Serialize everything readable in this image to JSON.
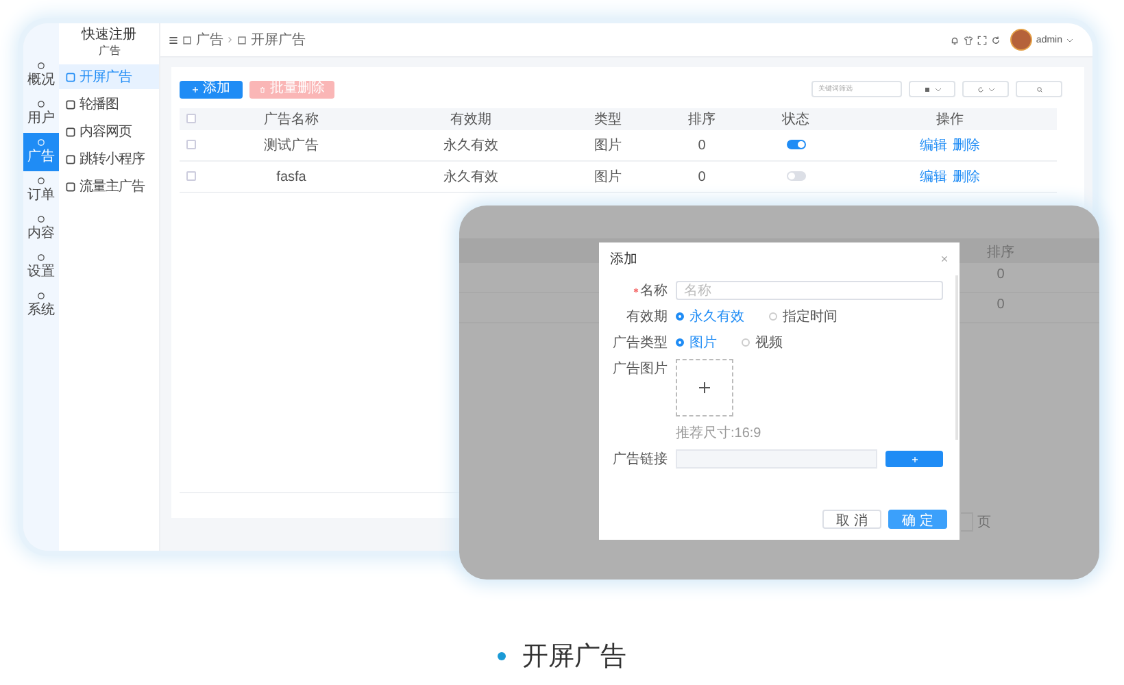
{
  "app": {
    "title": "快速注册",
    "subtitle": "广告"
  },
  "rail": [
    {
      "label": "概况",
      "selected": false
    },
    {
      "label": "用户",
      "selected": false
    },
    {
      "label": "广告",
      "selected": true
    },
    {
      "label": "订单",
      "selected": false
    },
    {
      "label": "内容",
      "selected": false
    },
    {
      "label": "设置",
      "selected": false
    },
    {
      "label": "系统",
      "selected": false
    }
  ],
  "submenu": [
    {
      "label": "开屏广告",
      "selected": true
    },
    {
      "label": "轮播图",
      "selected": false
    },
    {
      "label": "内容网页",
      "selected": false
    },
    {
      "label": "跳转小程序",
      "selected": false
    },
    {
      "label": "流量主广告",
      "selected": false
    }
  ],
  "breadcrumb": [
    "广告",
    "开屏广告"
  ],
  "user": {
    "name": "admin"
  },
  "toolbar": {
    "add": "添加",
    "batch_delete": {
      "label": "批量删除",
      "disabled": true
    },
    "search_placeholder": "关键词筛选"
  },
  "table": {
    "all_selected": false,
    "columns": [
      "广告名称",
      "有效期",
      "类型",
      "排序",
      "状态",
      "操作"
    ],
    "rows": [
      {
        "selected": false,
        "name": "测试广告",
        "validity": "永久有效",
        "type": "图片",
        "order": "0",
        "on": true,
        "actions": [
          "编辑",
          "删除"
        ]
      },
      {
        "selected": false,
        "name": "fasfa",
        "validity": "永久有效",
        "type": "图片",
        "order": "0",
        "on": false,
        "actions": [
          "编辑",
          "删除"
        ]
      }
    ]
  },
  "zoom_view": {
    "column": "排序",
    "rows": [
      "0",
      "0"
    ],
    "pager_unit": "页",
    "dialog": {
      "title": "添加",
      "fields": [
        {
          "kind": "text",
          "label": "名称",
          "required": true,
          "placeholder": "名称"
        },
        {
          "kind": "radio",
          "label": "有效期",
          "options": [
            {
              "label": "永久有效",
              "selected": true
            },
            {
              "label": "指定时间",
              "selected": false
            }
          ]
        },
        {
          "kind": "radio",
          "label": "广告类型",
          "options": [
            {
              "label": "图片",
              "selected": true
            },
            {
              "label": "视频",
              "selected": false
            }
          ]
        },
        {
          "kind": "upload",
          "label": "广告图片",
          "hint": "推荐尺寸:16:9"
        },
        {
          "kind": "link",
          "label": "广告链接"
        }
      ],
      "buttons": [
        {
          "label": "取 消",
          "kind": "default"
        },
        {
          "label": "确 定",
          "kind": "primary"
        }
      ]
    }
  },
  "caption": "开屏广告"
}
